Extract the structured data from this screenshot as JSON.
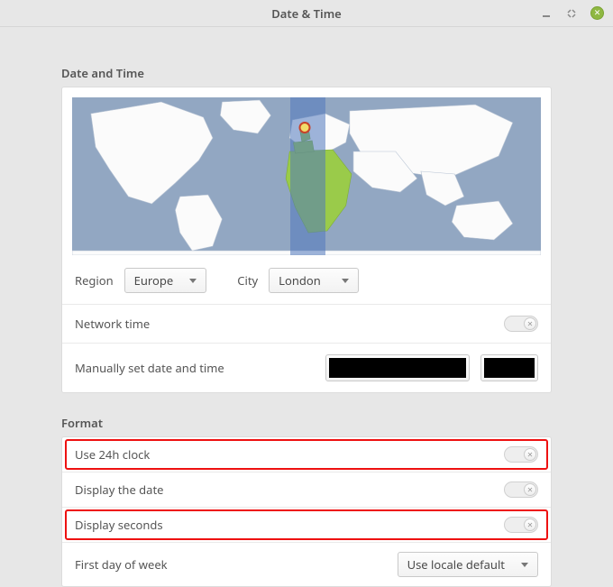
{
  "titlebar": {
    "title": "Date & Time"
  },
  "sections": {
    "date_time": {
      "heading": "Date and Time",
      "region_label": "Region",
      "region_value": "Europe",
      "city_label": "City",
      "city_value": "London",
      "network_time_label": "Network time",
      "network_time_on": false,
      "manual_label": "Manually set date and time"
    },
    "format": {
      "heading": "Format",
      "use_24h_label": "Use 24h clock",
      "use_24h_on": false,
      "display_date_label": "Display the date",
      "display_date_on": false,
      "display_seconds_label": "Display seconds",
      "display_seconds_on": false,
      "first_day_label": "First day of week",
      "first_day_value": "Use locale default"
    }
  }
}
